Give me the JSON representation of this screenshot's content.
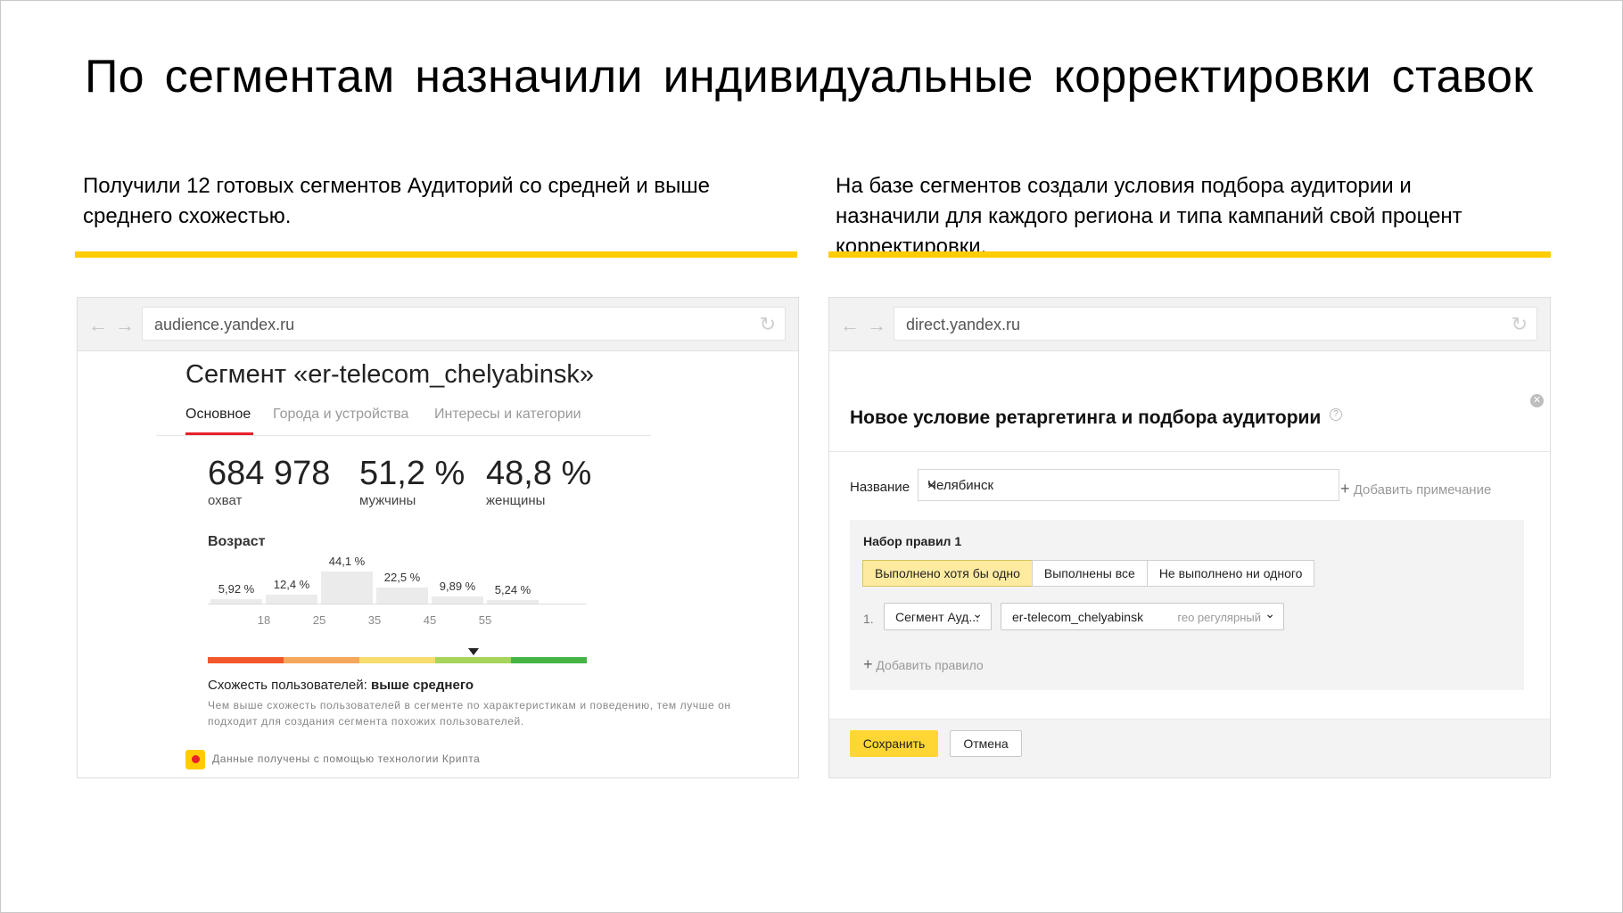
{
  "slide": {
    "title": "По сегментам назначили индивидуальные корректировки ставок",
    "left_text": "Получили 12 готовых сегментов Аудиторий со средней и выше среднего схожестью.",
    "right_text": "На базе сегментов создали условия подбора аудитории и назначили для каждого региона и типа кампаний свой процент корректировки.",
    "accent_color": "#ffcc00"
  },
  "left_browser": {
    "url": "audience.yandex.ru",
    "segment_title": "Сегмент «er-telecom_chelyabinsk»",
    "tabs": [
      "Основное",
      "Города и устройства",
      "Интересы и категории"
    ],
    "active_tab": "Основное",
    "stats": [
      {
        "value": "684 978",
        "label": "охват"
      },
      {
        "value": "51,2 %",
        "label": "мужчины"
      },
      {
        "value": "48,8 %",
        "label": "женщины"
      }
    ],
    "age": {
      "title": "Возраст",
      "bars": [
        {
          "pct": "5,92 %",
          "value": 5.92
        },
        {
          "pct": "12,4 %",
          "value": 12.4
        },
        {
          "pct": "44,1 %",
          "value": 44.1
        },
        {
          "pct": "22,5 %",
          "value": 22.5
        },
        {
          "pct": "9,89 %",
          "value": 9.89
        },
        {
          "pct": "5,24 %",
          "value": 5.24
        }
      ],
      "ticks": [
        "18",
        "25",
        "35",
        "45",
        "55"
      ]
    },
    "similarity": {
      "label": "Схожесть пользователей:",
      "value": "выше среднего",
      "description": "Чем выше схожесть пользователей в сегменте по характеристикам и поведению, тем лучше он подходит для создания сегмента похожих пользователей.",
      "scale_colors": [
        "#f2572b",
        "#f5a85c",
        "#f7dc6f",
        "#a6d35a",
        "#45b445"
      ],
      "level": 0.7
    },
    "crypta_text": "Данные получены с помощью технологии Крипта"
  },
  "right_browser": {
    "url": "direct.yandex.ru",
    "dialog_title": "Новое условие ретаргетинга и подбора аудитории",
    "name_label": "Название",
    "name_value": "Челябинск",
    "add_note": "Добавить примечание",
    "ruleset_title": "Набор правил 1",
    "radio_options": [
      "Выполнено хотя бы одно",
      "Выполнены все",
      "Не выполнено ни одного"
    ],
    "radio_selected": "Выполнено хотя бы одно",
    "rule_number": "1.",
    "rule_type": "Сегмент Ауд...",
    "rule_segment": "er-telecom_chelyabinsk",
    "rule_segment_sub": "гео регулярный",
    "add_rule": "Добавить правило",
    "save_button": "Сохранить",
    "cancel_button": "Отмена"
  }
}
